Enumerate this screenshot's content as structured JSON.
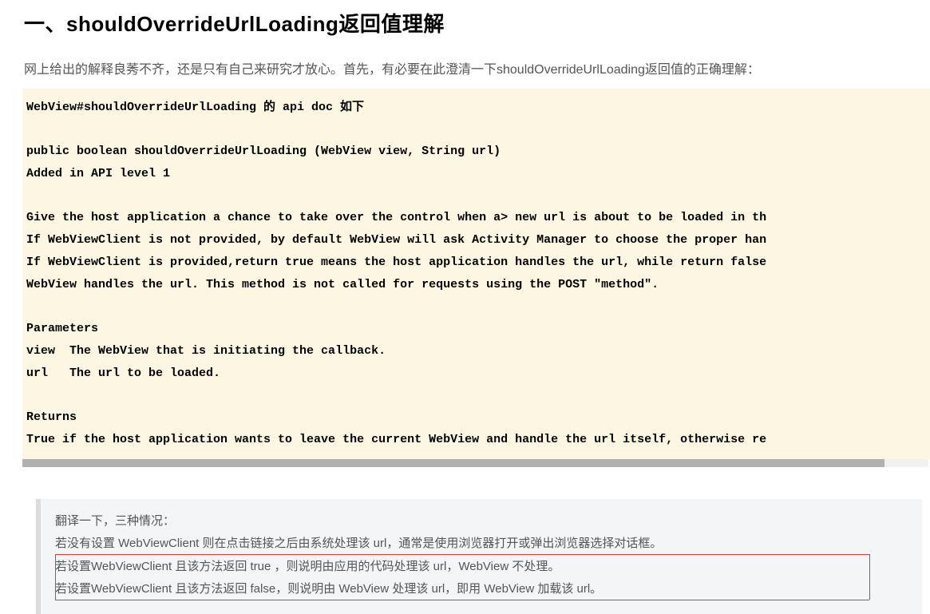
{
  "heading": "一、shouldOverrideUrlLoading返回值理解",
  "intro": "网上给出的解释良莠不齐，还是只有自己来研究才放心。首先，有必要在此澄清一下shouldOverrideUrlLoading返回值的正确理解：",
  "code": {
    "line1": "WebView#shouldOverrideUrlLoading 的 api doc 如下",
    "line2": "",
    "line3": "public boolean shouldOverrideUrlLoading (WebView view, String url)",
    "line4": "Added in API level 1",
    "line5": "",
    "line6": "Give the host application a chance to take over the control when a> new url is about to be loaded in th",
    "line7": "If WebViewClient is not provided, by default WebView will ask Activity Manager to choose the proper han",
    "line8": "If WebViewClient is provided,return true means the host application handles the url, while return false",
    "line9": "WebView handles the url. This method is not called for requests using the POST \"method\".",
    "line10": "",
    "line11": "Parameters",
    "line12": "view  The WebView that is initiating the callback.",
    "line13": "url   The url to be loaded.",
    "line14": "",
    "line15": "Returns",
    "line16": "True if the host application wants to leave the current WebView and handle the url itself, otherwise re"
  },
  "quote": {
    "line1": "翻译一下，三种情况：",
    "line2_part1": "若没有设置 WebViewClient ",
    "line2_part2": "则在点击链接之后由系统处理该 url，通常是使用浏览器打开或弹出浏览器选择对话框。",
    "line3_part1": "若设置WebViewClient 且该方法返回 true ",
    "line3_part2": "，则说明由应用的代码处理该 url，WebView 不处理。",
    "line4_part1": "若设置WebViewClient 且该方法返回 false",
    "line4_part2": "，则说明由 WebView 处理该 url，即用 WebView 加载该 url。"
  }
}
